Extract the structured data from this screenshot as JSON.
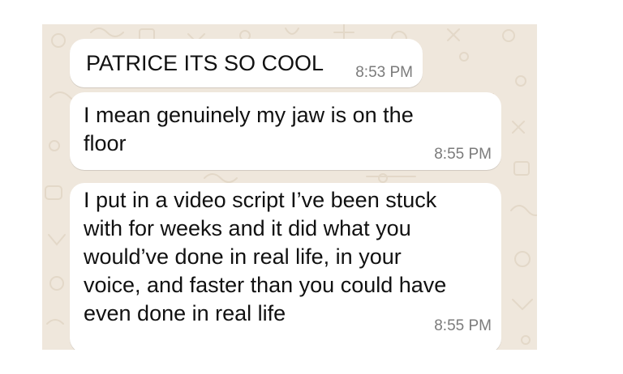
{
  "colors": {
    "chat_background": "#efe7dc",
    "bubble_background": "#ffffff",
    "message_text": "#111111",
    "timestamp_text": "#7b7b7b",
    "wallpaper_doodle": "#e3d8c8"
  },
  "messages": [
    {
      "text": "PATRICE ITS SO COOL",
      "time": "8:53 PM"
    },
    {
      "text": "I mean genuinely my jaw is on the\nfloor",
      "time": "8:55 PM"
    },
    {
      "text": "I put in a video script I’ve been stuck\nwith for weeks and it did what you\nwould’ve done in real life, in your\nvoice, and faster than you could have\neven done in real life",
      "time": "8:55 PM"
    }
  ]
}
